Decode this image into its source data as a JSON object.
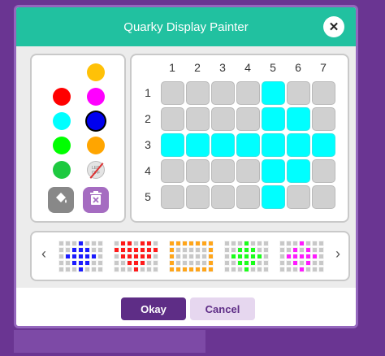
{
  "dialog": {
    "title": "Quarky Display Painter",
    "close_icon": "close-icon"
  },
  "palette": {
    "colors": [
      "#ffffff",
      "#ffc107",
      "#ff0000",
      "#ff00ff",
      "#00ffff",
      "#0000ee",
      "#00ff00",
      "#ffa500",
      "#1ec940"
    ],
    "selected_color": "#0000ee",
    "off_swatch": {
      "label": "LED OFF",
      "icon": "led-off-icon"
    },
    "tools": [
      {
        "name": "fill-bucket-icon",
        "color": "#888888"
      },
      {
        "name": "trash-icon",
        "color": "#a56cc1"
      }
    ]
  },
  "grid": {
    "columns": [
      "1",
      "2",
      "3",
      "4",
      "5",
      "6",
      "7"
    ],
    "rows": [
      "1",
      "2",
      "3",
      "4",
      "5"
    ],
    "cells": [
      [
        0,
        0,
        0,
        0,
        1,
        0,
        0
      ],
      [
        0,
        0,
        0,
        0,
        1,
        1,
        0
      ],
      [
        1,
        1,
        1,
        1,
        1,
        1,
        1
      ],
      [
        0,
        0,
        0,
        0,
        1,
        1,
        0
      ],
      [
        0,
        0,
        0,
        0,
        1,
        0,
        0
      ]
    ],
    "on_color": "#00ffff",
    "off_color": "#d0d0d0"
  },
  "presets": {
    "prev_icon": "chevron-left-icon",
    "next_icon": "chevron-right-icon",
    "items": [
      {
        "color": "#1a1aff",
        "cells": [
          [
            0,
            0,
            0,
            1,
            0,
            0,
            0
          ],
          [
            0,
            0,
            1,
            1,
            1,
            0,
            0
          ],
          [
            0,
            1,
            1,
            1,
            1,
            1,
            0
          ],
          [
            0,
            0,
            1,
            1,
            1,
            0,
            0
          ],
          [
            0,
            0,
            0,
            1,
            0,
            0,
            0
          ]
        ]
      },
      {
        "color": "#ff1a1a",
        "cells": [
          [
            0,
            1,
            1,
            0,
            1,
            1,
            0
          ],
          [
            1,
            1,
            1,
            1,
            1,
            1,
            1
          ],
          [
            0,
            1,
            1,
            1,
            1,
            1,
            0
          ],
          [
            0,
            0,
            1,
            1,
            1,
            0,
            0
          ],
          [
            0,
            0,
            0,
            1,
            0,
            0,
            0
          ]
        ]
      },
      {
        "color": "#ffa51a",
        "cells": [
          [
            1,
            1,
            1,
            1,
            1,
            1,
            1
          ],
          [
            1,
            0,
            0,
            0,
            0,
            0,
            1
          ],
          [
            1,
            0,
            0,
            0,
            0,
            0,
            1
          ],
          [
            1,
            0,
            0,
            0,
            0,
            0,
            1
          ],
          [
            1,
            1,
            1,
            1,
            1,
            1,
            1
          ]
        ]
      },
      {
        "color": "#1aff1a",
        "cells": [
          [
            0,
            0,
            0,
            1,
            0,
            0,
            0
          ],
          [
            0,
            0,
            1,
            1,
            1,
            0,
            0
          ],
          [
            0,
            1,
            1,
            1,
            1,
            1,
            0
          ],
          [
            0,
            0,
            1,
            1,
            1,
            0,
            0
          ],
          [
            0,
            0,
            0,
            1,
            0,
            0,
            0
          ]
        ]
      },
      {
        "color": "#ff1aff",
        "cells": [
          [
            0,
            0,
            0,
            1,
            0,
            0,
            0
          ],
          [
            0,
            0,
            1,
            0,
            1,
            0,
            0
          ],
          [
            0,
            1,
            1,
            1,
            1,
            1,
            0
          ],
          [
            0,
            0,
            1,
            0,
            1,
            0,
            0
          ],
          [
            0,
            0,
            0,
            1,
            0,
            0,
            0
          ]
        ]
      }
    ]
  },
  "footer": {
    "ok_label": "Okay",
    "cancel_label": "Cancel"
  }
}
